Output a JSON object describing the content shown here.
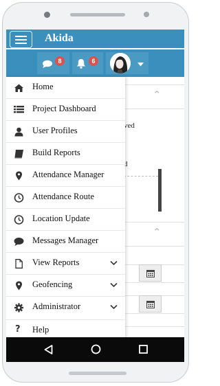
{
  "app": {
    "title": "Akida"
  },
  "notifications": {
    "messages_count": "8",
    "alerts_count": "6"
  },
  "background": {
    "partial_text_1": "ved",
    "partial_text_2": "d"
  },
  "menu": {
    "items": [
      {
        "label": "Home",
        "icon": "home-icon",
        "expandable": false
      },
      {
        "label": "Project Dashboard",
        "icon": "list-icon",
        "expandable": false
      },
      {
        "label": "User Profiles",
        "icon": "user-icon",
        "expandable": false
      },
      {
        "label": "Build Reports",
        "icon": "book-icon",
        "expandable": false
      },
      {
        "label": "Attendance Manager",
        "icon": "map-marker-icon",
        "expandable": false
      },
      {
        "label": "Attendance Route",
        "icon": "clock-icon",
        "expandable": false
      },
      {
        "label": "Location Update",
        "icon": "clock-icon",
        "expandable": false
      },
      {
        "label": "Messages Manager",
        "icon": "comment-icon",
        "expandable": false
      },
      {
        "label": "View Reports",
        "icon": "file-icon",
        "expandable": true
      },
      {
        "label": "Geofencing",
        "icon": "map-marker-icon",
        "expandable": true
      },
      {
        "label": "Administrator",
        "icon": "gear-icon",
        "expandable": true
      },
      {
        "label": "Help",
        "icon": "question-icon",
        "expandable": false
      }
    ]
  },
  "colors": {
    "topbar": "#3a8fbd",
    "badge": "#d9534f",
    "navbar": "#0a0a0a"
  }
}
